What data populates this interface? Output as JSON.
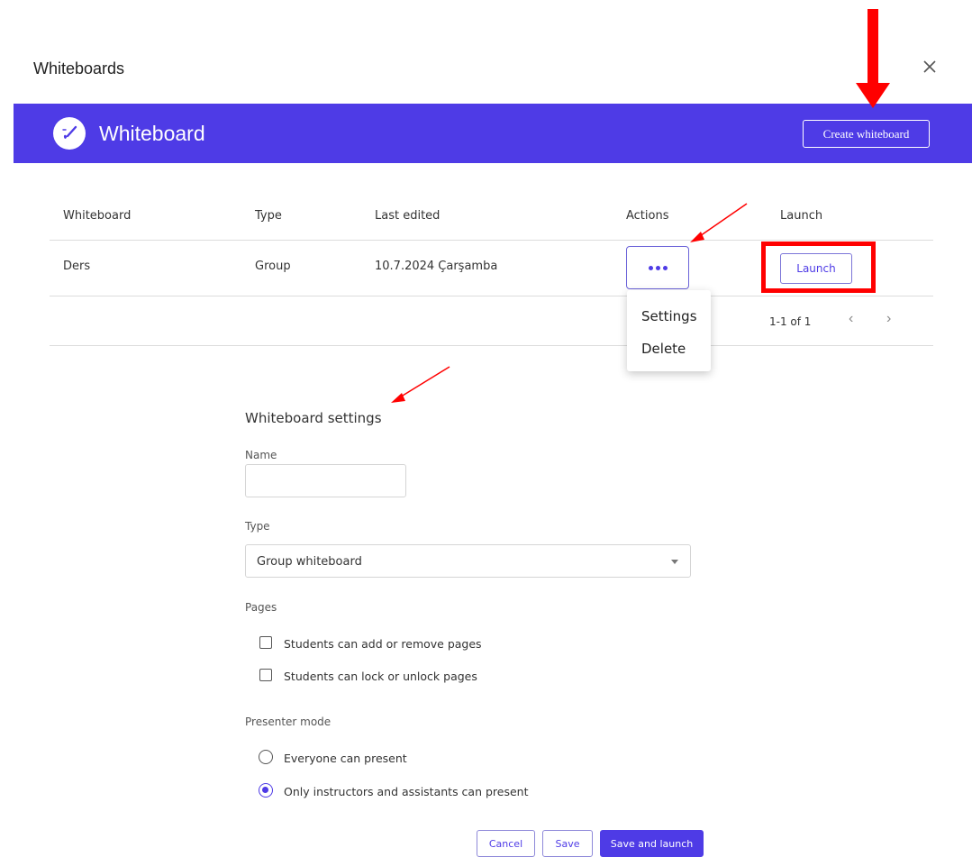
{
  "dialog": {
    "title": "Whiteboards"
  },
  "banner": {
    "title": "Whiteboard",
    "create_label": "Create whiteboard"
  },
  "table": {
    "headers": [
      "Whiteboard",
      "Type",
      "Last edited",
      "Actions",
      "Launch"
    ],
    "rows": [
      {
        "name": "Ders",
        "type": "Group",
        "last_edited": "10.7.2024 Çarşamba",
        "launch_label": "Launch"
      }
    ],
    "pagination": "1-1 of 1"
  },
  "actions_menu": {
    "items": [
      "Settings",
      "Delete"
    ]
  },
  "settings": {
    "title": "Whiteboard settings",
    "name_label": "Name",
    "name_value": "",
    "type_label": "Type",
    "type_value": "Group whiteboard",
    "pages_label": "Pages",
    "pages_options": [
      {
        "label": "Students can add or remove pages",
        "checked": false
      },
      {
        "label": "Students can lock or unlock pages",
        "checked": false
      }
    ],
    "presenter_label": "Presenter mode",
    "presenter_options": [
      {
        "label": "Everyone can present",
        "selected": false
      },
      {
        "label": "Only instructors and assistants can present",
        "selected": true
      }
    ]
  },
  "footer": {
    "cancel": "Cancel",
    "save": "Save",
    "save_launch": "Save and launch"
  },
  "colors": {
    "brand": "#4e3be6",
    "annotation": "#ff0000"
  }
}
